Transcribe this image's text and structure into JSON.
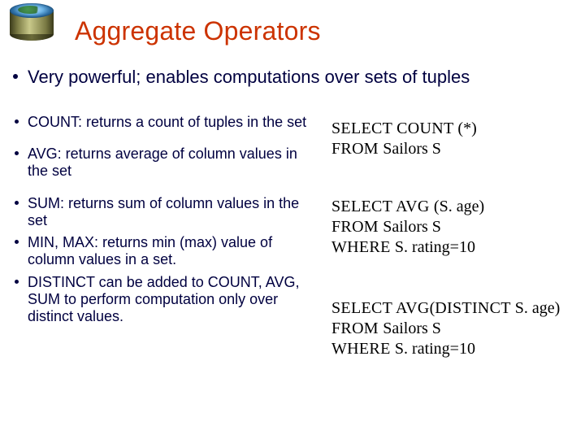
{
  "title": "Aggregate Operators",
  "lead": "Very powerful; enables computations over sets of tuples",
  "left": {
    "items": [
      "COUNT: returns a count of tuples in the set",
      "AVG: returns average of column values in the set",
      "SUM: returns sum of column values in the set",
      "MIN, MAX: returns min (max) value of column values in a set.",
      "DISTINCT can be added to COUNT, AVG, SUM to perform computation only over distinct values."
    ]
  },
  "right": {
    "q1": {
      "l1a": "SELECT  COUNT ",
      "l1b": "(*)",
      "l2a": "FROM  ",
      "l2b": "Sailors S"
    },
    "q2": {
      "l1a": "SELECT  AVG ",
      "l1b": "(S. age)",
      "l2a": "FROM  ",
      "l2b": "Sailors S",
      "l3a": "WHERE  ",
      "l3b": "S. rating=10"
    },
    "q3": {
      "l1a": "SELECT  AVG",
      "l1b": "(",
      "l1c": "DISTINCT ",
      "l1d": "S. age)",
      "l2a": "FROM  ",
      "l2b": "Sailors S",
      "l3a": "WHERE  ",
      "l3b": "S. rating=10"
    }
  }
}
